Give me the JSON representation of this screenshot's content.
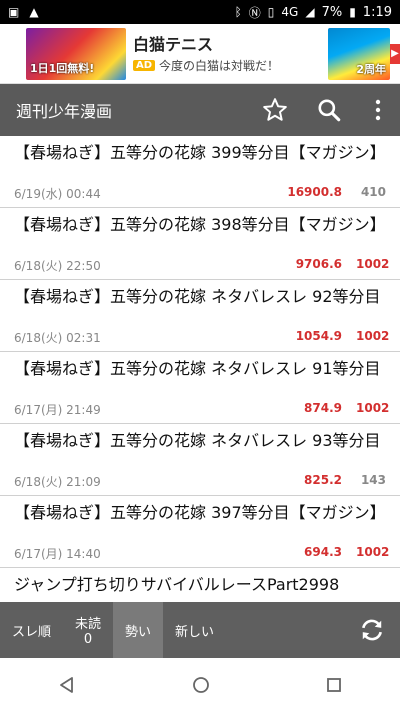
{
  "status": {
    "network": "4G",
    "battery": "7%",
    "time": "1:19"
  },
  "ad": {
    "title": "白猫テニス",
    "badge": "AD",
    "subtitle": "今度の白猫は対戦だ！",
    "left_text": "1日1回無料!",
    "right_text": "2周年"
  },
  "appbar": {
    "title": "週刊少年漫画",
    "icons": [
      "star-icon",
      "search-icon",
      "more-vert-icon"
    ]
  },
  "threads": [
    {
      "title": "【春場ねぎ】五等分の花嫁 399等分目【マガジン】",
      "date": "6/19(水) 00:44",
      "ikioi": "16900.8",
      "count": "410",
      "count_color": "gray"
    },
    {
      "title": "【春場ねぎ】五等分の花嫁 398等分目【マガジン】",
      "date": "6/18(火) 22:50",
      "ikioi": "9706.6",
      "count": "1002",
      "count_color": "red"
    },
    {
      "title": "【春場ねぎ】五等分の花嫁 ネタバレスレ 92等分目",
      "date": "6/18(火) 02:31",
      "ikioi": "1054.9",
      "count": "1002",
      "count_color": "red"
    },
    {
      "title": "【春場ねぎ】五等分の花嫁 ネタバレスレ 91等分目",
      "date": "6/17(月) 21:49",
      "ikioi": "874.9",
      "count": "1002",
      "count_color": "red"
    },
    {
      "title": "【春場ねぎ】五等分の花嫁 ネタバレスレ 93等分目",
      "date": "6/18(火) 21:09",
      "ikioi": "825.2",
      "count": "143",
      "count_color": "gray"
    },
    {
      "title": "【春場ねぎ】五等分の花嫁 397等分目【マガジン】",
      "date": "6/17(月) 14:40",
      "ikioi": "694.3",
      "count": "1002",
      "count_color": "red"
    },
    {
      "title": "ジャンプ打ち切りサバイバルレースPart2998",
      "date": "",
      "ikioi": "",
      "count": "",
      "count_color": "red"
    }
  ],
  "bottom": {
    "sort_thread": "スレ順",
    "unread_label": "未読",
    "unread_count": "0",
    "ikioi": "勢い",
    "new": "新しい"
  }
}
